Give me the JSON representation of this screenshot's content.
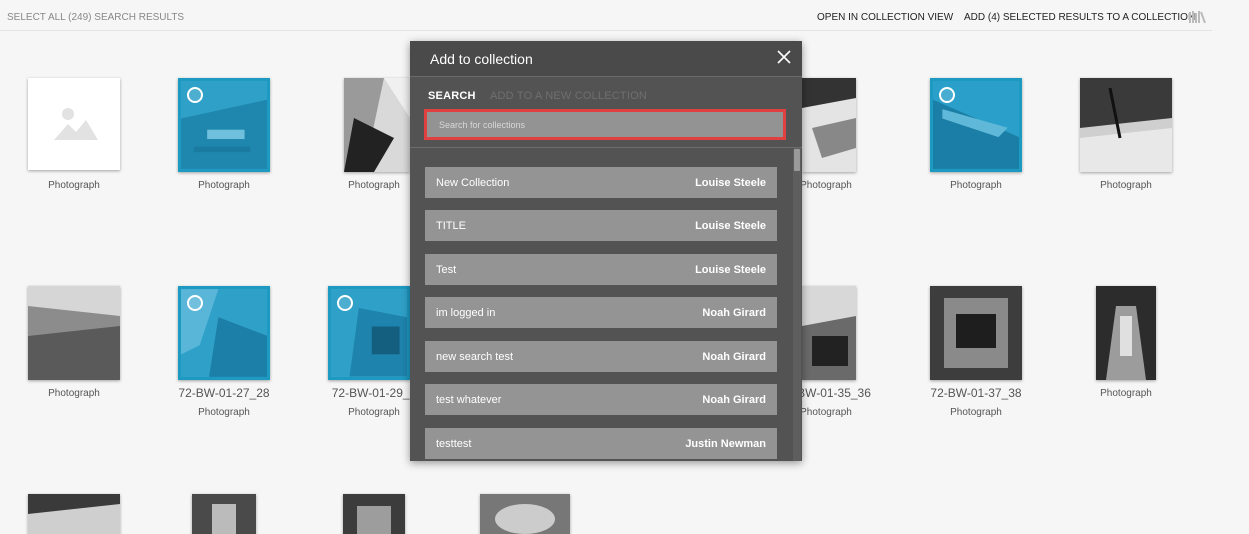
{
  "toolbar": {
    "select_all": "SELECT ALL (249) SEARCH RESULTS",
    "open_collection_view": "OPEN IN COLLECTION VIEW",
    "add_selected": "ADD (4) SELECTED RESULTS TO A COLLECTION"
  },
  "results": [
    {
      "id": "",
      "type": "Photograph",
      "selected": false,
      "placeholder": true
    },
    {
      "id": "",
      "type": "Photograph",
      "selected": true
    },
    {
      "id": "",
      "type": "Photograph",
      "selected": false
    },
    {
      "id": "",
      "type": "Photograph",
      "selected": false
    },
    {
      "id": "",
      "type": "Photograph",
      "selected": true
    },
    {
      "id": "",
      "type": "Photograph",
      "selected": false
    },
    {
      "id": "",
      "type": "Photograph",
      "selected": false
    },
    {
      "id": "72-BW-01-27_28",
      "type": "Photograph",
      "selected": true
    },
    {
      "id": "72-BW-01-29_3",
      "type": "Photograph",
      "selected": true
    },
    {
      "id": "BW-01-35_36",
      "type": "Photograph",
      "selected": false
    },
    {
      "id": "72-BW-01-37_38",
      "type": "Photograph",
      "selected": false
    },
    {
      "id": "",
      "type": "Photograph",
      "selected": false
    }
  ],
  "modal": {
    "title": "Add to collection",
    "tab_search": "SEARCH",
    "tab_new": "ADD TO A NEW COLLECTION",
    "search_placeholder": "Search for collections",
    "collections": [
      {
        "name": "New Collection",
        "owner": "Louise Steele"
      },
      {
        "name": "TITLE",
        "owner": "Louise Steele"
      },
      {
        "name": "Test",
        "owner": "Louise Steele"
      },
      {
        "name": "im logged in",
        "owner": "Noah Girard"
      },
      {
        "name": "new search test",
        "owner": "Noah Girard"
      },
      {
        "name": "test whatever",
        "owner": "Noah Girard"
      },
      {
        "name": "testtest",
        "owner": "Justin Newman"
      }
    ]
  },
  "colors": {
    "selection": "#1d9ac2",
    "highlight": "#e04040",
    "modal_bg": "#535353",
    "row_bg": "#949494"
  }
}
